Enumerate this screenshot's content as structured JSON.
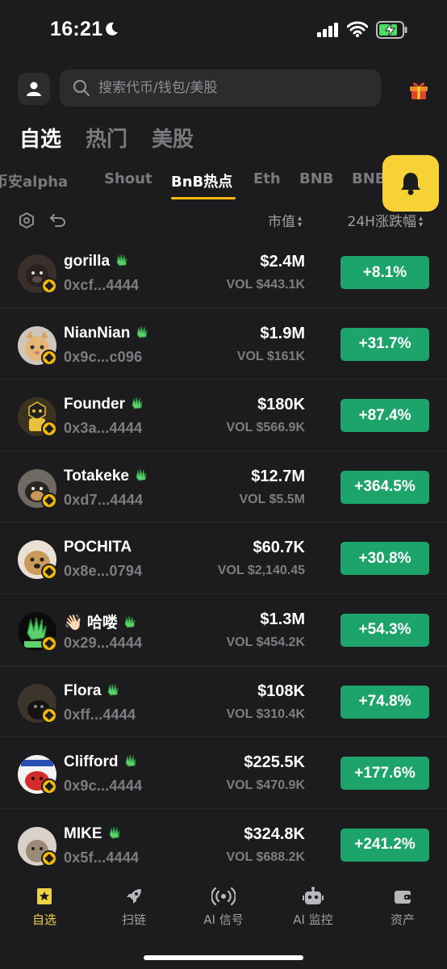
{
  "status": {
    "time": "16:21"
  },
  "search": {
    "placeholder": "搜索代币/钱包/美股"
  },
  "main_tabs": [
    {
      "label": "自选",
      "active": true
    },
    {
      "label": "热门",
      "active": false
    },
    {
      "label": "美股",
      "active": false
    }
  ],
  "sub_tabs": [
    {
      "label": "币安alpha",
      "active": false
    },
    {
      "label": "Shout",
      "active": false
    },
    {
      "label": "BnB热点",
      "active": true
    },
    {
      "label": "Eth",
      "active": false
    },
    {
      "label": "BNB",
      "active": false
    },
    {
      "label": "BNB",
      "active": false
    }
  ],
  "list_header": {
    "mcap_label": "市值",
    "change_label": "24H涨跌幅"
  },
  "tokens": [
    {
      "name": "gorilla",
      "address": "0xcf...4444",
      "mcap": "$2.4M",
      "vol": "VOL $443.1K",
      "change": "+8.1%",
      "avatar": "gorilla-avatar"
    },
    {
      "name": "NianNian",
      "address": "0x9c...c096",
      "mcap": "$1.9M",
      "vol": "VOL $161K",
      "change": "+31.7%",
      "avatar": "cat-avatar"
    },
    {
      "name": "Founder",
      "address": "0x3a...4444",
      "mcap": "$180K",
      "vol": "VOL $566.9K",
      "change": "+87.4%",
      "avatar": "founder-avatar"
    },
    {
      "name": "Totakeke",
      "address": "0xd7...4444",
      "mcap": "$12.7M",
      "vol": "VOL $5.5M",
      "change": "+364.5%",
      "avatar": "dog-avatar"
    },
    {
      "name": "POCHITA",
      "address": "0x8e...0794",
      "mcap": "$60.7K",
      "vol": "VOL $2,140.45",
      "change": "+30.8%",
      "avatar": "pochita-avatar"
    },
    {
      "name": "👋🏻 哈喽",
      "address": "0x29...4444",
      "mcap": "$1.3M",
      "vol": "VOL $454.2K",
      "change": "+54.3%",
      "avatar": "hello-hand-avatar"
    },
    {
      "name": "Flora",
      "address": "0xff...4444",
      "mcap": "$108K",
      "vol": "VOL $310.4K",
      "change": "+74.8%",
      "avatar": "flora-avatar"
    },
    {
      "name": "Clifford",
      "address": "0x9c...4444",
      "mcap": "$225.5K",
      "vol": "VOL $470.9K",
      "change": "+177.6%",
      "avatar": "clifford-avatar"
    },
    {
      "name": "MIKE",
      "address": "0x5f...4444",
      "mcap": "$324.8K",
      "vol": "VOL $688.2K",
      "change": "+241.2%",
      "avatar": "mike-avatar"
    }
  ],
  "bottom_nav": [
    {
      "label": "自选",
      "icon": "star-bookmark-icon",
      "active": true
    },
    {
      "label": "扫链",
      "icon": "rocket-icon",
      "active": false
    },
    {
      "label": "AI 信号",
      "icon": "broadcast-icon",
      "active": false
    },
    {
      "label": "AI 监控",
      "icon": "robot-icon",
      "active": false
    },
    {
      "label": "资产",
      "icon": "wallet-icon",
      "active": false
    }
  ],
  "colors": {
    "accent": "#f0b90b",
    "positive": "#1ca46b",
    "bell_fab": "#f7d237",
    "background": "#1c1c1e"
  }
}
